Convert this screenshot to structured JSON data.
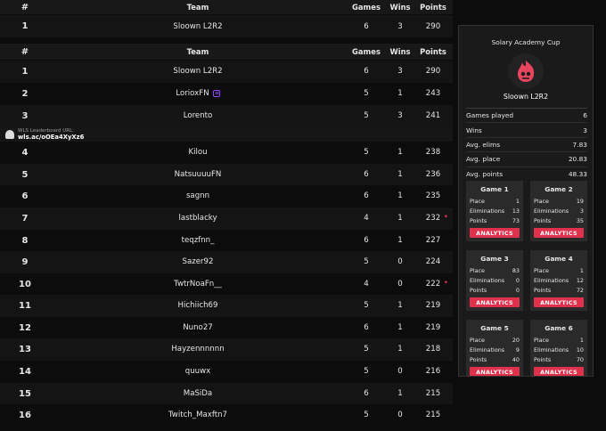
{
  "header": {
    "rank": "#",
    "team": "Team",
    "games": "Games",
    "wins": "Wins",
    "points": "Points"
  },
  "pinned": {
    "rank": "1",
    "team": "Sloown L2R2",
    "games": "6",
    "wins": "3",
    "points": "290"
  },
  "rows": [
    {
      "rank": "1",
      "team": "Sloown L2R2",
      "games": "6",
      "wins": "3",
      "points": "290"
    },
    {
      "rank": "2",
      "team": "LorioxFN",
      "games": "5",
      "wins": "1",
      "points": "243"
    },
    {
      "rank": "3",
      "team": "Lorento",
      "games": "5",
      "wins": "3",
      "points": "241"
    },
    {
      "rank": "4",
      "team": "Kilou",
      "games": "5",
      "wins": "1",
      "points": "238"
    },
    {
      "rank": "5",
      "team": "NatsuuuuFN",
      "games": "6",
      "wins": "1",
      "points": "236"
    },
    {
      "rank": "6",
      "team": "sagnn",
      "games": "6",
      "wins": "1",
      "points": "235"
    },
    {
      "rank": "7",
      "team": "lastblacky",
      "games": "4",
      "wins": "1",
      "points": "232"
    },
    {
      "rank": "8",
      "team": "teqzfnn_",
      "games": "6",
      "wins": "1",
      "points": "227"
    },
    {
      "rank": "9",
      "team": "Sazer92",
      "games": "5",
      "wins": "0",
      "points": "224"
    },
    {
      "rank": "10",
      "team": "TwtrNoaFn__",
      "games": "4",
      "wins": "0",
      "points": "222"
    },
    {
      "rank": "11",
      "team": "Hichiich69",
      "games": "5",
      "wins": "1",
      "points": "219"
    },
    {
      "rank": "12",
      "team": "Nuno27",
      "games": "6",
      "wins": "1",
      "points": "219"
    },
    {
      "rank": "13",
      "team": "Hayzennnnnn",
      "games": "5",
      "wins": "1",
      "points": "218"
    },
    {
      "rank": "14",
      "team": "quuwx",
      "games": "5",
      "wins": "0",
      "points": "216"
    },
    {
      "rank": "15",
      "team": "MaSiDa",
      "games": "6",
      "wins": "1",
      "points": "215"
    },
    {
      "rank": "16",
      "team": "Twitch_Maxftn7",
      "games": "5",
      "wins": "0",
      "points": "215"
    }
  ],
  "banner": {
    "label": "WLS Leaderboard URL:",
    "url": "wls.ac/oOEa4XyXz6"
  },
  "panel": {
    "title": "Solary Academy Cup",
    "team": "Sloown L2R2",
    "stats": [
      {
        "label": "Games played",
        "value": "6"
      },
      {
        "label": "Wins",
        "value": "3"
      },
      {
        "label": "Avg. elims",
        "value": "7.83"
      },
      {
        "label": "Avg. place",
        "value": "20.83"
      },
      {
        "label": "Avg. points",
        "value": "48.33"
      }
    ],
    "place_label": "Place",
    "elims_label": "Eliminations",
    "points_label": "Points",
    "analytics_label": "ANALYTICS",
    "games": [
      {
        "title": "Game 1",
        "place": "1",
        "elims": "13",
        "points": "73"
      },
      {
        "title": "Game 2",
        "place": "19",
        "elims": "3",
        "points": "35"
      },
      {
        "title": "Game 3",
        "place": "83",
        "elims": "0",
        "points": "0"
      },
      {
        "title": "Game 4",
        "place": "1",
        "elims": "12",
        "points": "72"
      },
      {
        "title": "Game 5",
        "place": "20",
        "elims": "9",
        "points": "40"
      },
      {
        "title": "Game 6",
        "place": "1",
        "elims": "10",
        "points": "70"
      }
    ]
  },
  "colors": {
    "accent": "#e0304c",
    "twitch": "#9146ff"
  }
}
